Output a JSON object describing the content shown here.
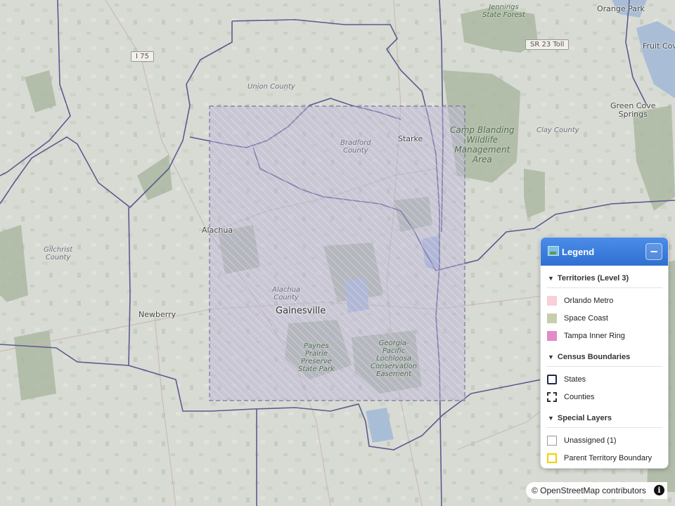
{
  "map": {
    "places": [
      {
        "key": "orange_park",
        "label": "Orange Park"
      },
      {
        "key": "fruit_cove",
        "label": "Fruit Cove"
      },
      {
        "key": "green_cove",
        "label": "Green Cove\nSprings"
      },
      {
        "key": "starke",
        "label": "Starke"
      },
      {
        "key": "alachua",
        "label": "Alachua"
      },
      {
        "key": "newberry",
        "label": "Newberry"
      },
      {
        "key": "gainesville",
        "label": "Gainesville"
      }
    ],
    "counties": {
      "union": "Union County",
      "bradford": "Bradford\nCounty",
      "clay": "Clay County",
      "gilchrist": "Gilchrist\nCounty",
      "alachua": "Alachua\nCounty"
    },
    "parks": {
      "jennings": "Jennings\nState Forest",
      "camp_blanding": "Camp Blanding\nWildlife\nManagement\nArea",
      "paynes_prairie": "Paynes\nPrairie\nPreserve\nState Park",
      "lochloosa": "Georgia-\nPacific\nLochloosa\nConservation\nEasement"
    },
    "roads": {
      "i75": "I 75",
      "sr23": "SR 23 Toll"
    }
  },
  "legend": {
    "title": "Legend",
    "collapse_symbol": "−",
    "sections": [
      {
        "heading": "Territories (Level 3)",
        "items": [
          {
            "label": "Orlando Metro",
            "fill": "#f9cfd8",
            "border": "#f9cfd8",
            "style": "solid"
          },
          {
            "label": "Space Coast",
            "fill": "#c9cdb0",
            "border": "#c9cdb0",
            "style": "solid"
          },
          {
            "label": "Tampa Inner Ring",
            "fill": "#e38bc8",
            "border": "#e38bc8",
            "style": "solid"
          }
        ]
      },
      {
        "heading": "Census Boundaries",
        "items": [
          {
            "label": "States",
            "fill": "#ffffff",
            "border": "#1f2a44",
            "style": "solid"
          },
          {
            "label": "Counties",
            "fill": "#ffffff",
            "border": "#333333",
            "style": "dashed"
          }
        ]
      },
      {
        "heading": "Special Layers",
        "items": [
          {
            "label": "Unassigned (1)",
            "fill": "#ffffff",
            "border": "#999999",
            "style": "solid"
          },
          {
            "label": "Parent Territory Boundary",
            "fill": "#ffffff",
            "border": "#f2d200",
            "style": "solid"
          }
        ]
      }
    ]
  },
  "attribution": {
    "text": "© OpenStreetMap contributors",
    "info_symbol": "i"
  },
  "colors": {
    "map_bg": "#d6d9d1",
    "forest": "#a8b69e",
    "county_line": "#5a5890",
    "territory_fill": "#b7b0d6",
    "header_blue": "#3a7bdc"
  }
}
